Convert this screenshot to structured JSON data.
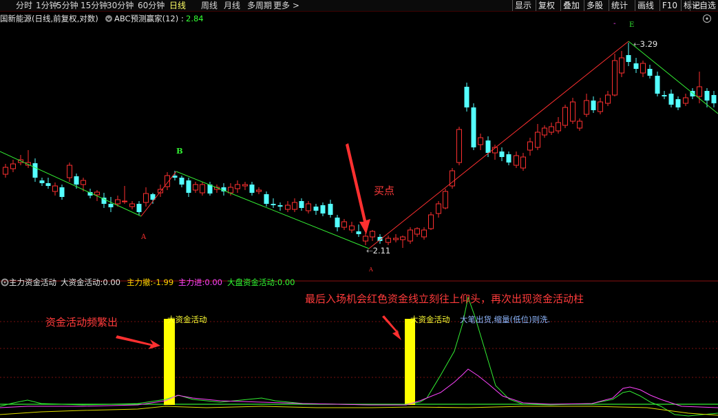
{
  "toolbar": {
    "periods": [
      "分时",
      "1分钟",
      "5分钟",
      "15分钟",
      "30分钟",
      "60分钟",
      "日线",
      "周线",
      "月线",
      "多周期",
      "更多 >"
    ],
    "active_period": "日线",
    "tools": [
      "显示",
      "复权",
      "叠加",
      "多股",
      "统计",
      "画线",
      "F10",
      "标记",
      "+自选"
    ]
  },
  "stock_info": {
    "title": "国新能源(日线,前复权,对数)",
    "indicator_name": "ABC预测赢家(12)",
    "indicator_sep": ":",
    "indicator_value": "2.84"
  },
  "price_labels": {
    "high": "3.29",
    "low": "2.11",
    "wave_labels": [
      "A",
      "B",
      "A",
      "E"
    ],
    "small_mark": "-"
  },
  "annotations": {
    "buy_point": "买点",
    "lower_note": "最后入场机会红色资金线立刻往上仰头，再次出现资金活动柱",
    "left_note": "资金活动频繁出"
  },
  "indicator_panel": {
    "name": "主力资金活动",
    "fields": [
      {
        "label": "大资金活动:",
        "value": "0.00",
        "color": "#e0e0e0"
      },
      {
        "label": "主力撤:",
        "value": "-1.99",
        "color": "#ffd400"
      },
      {
        "label": "主力进:",
        "value": "0.00",
        "color": "#ff44ff"
      },
      {
        "label": "大盘资金活动:",
        "value": "0.00",
        "color": "#33ff33"
      }
    ],
    "bar_label": "大资金活动",
    "sell_note": "大笔出货,缩量(低位)则洗."
  },
  "colors": {
    "up": "#ff3030",
    "down": "#54ffff",
    "accent": "#ffff00",
    "green_line": "#33ee33",
    "magenta_line": "#ff44ff"
  },
  "icons": [
    "settings-gear-icon",
    "indicator-toggle-icon",
    "more-circle-icon"
  ]
}
